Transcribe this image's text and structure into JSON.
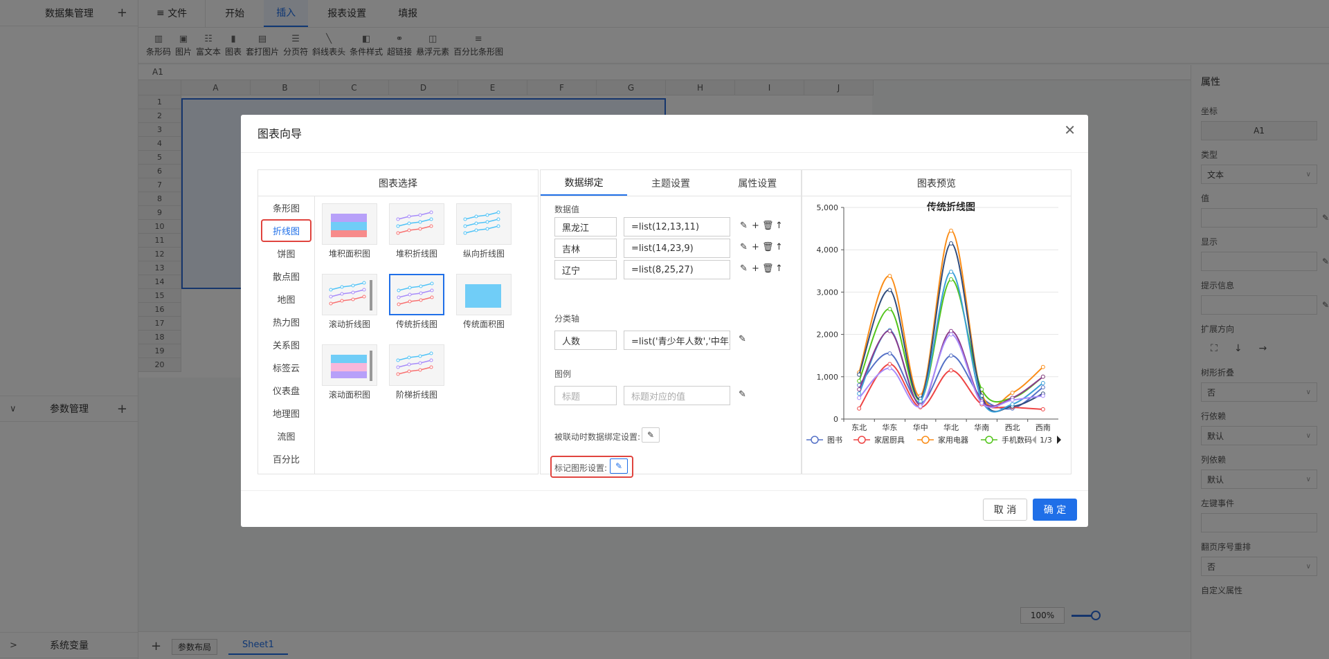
{
  "left_panel": {
    "dataset": "数据集管理",
    "params": "参数管理",
    "sysvars": "系统变量"
  },
  "top": {
    "file": "文件",
    "tabs": [
      "开始",
      "插入",
      "报表设置",
      "填报"
    ],
    "active_tab": "插入"
  },
  "ribbon": [
    {
      "icon": "barcode-icon",
      "label": "条形码"
    },
    {
      "icon": "image-icon",
      "label": "图片"
    },
    {
      "icon": "richtext-icon",
      "label": "富文本"
    },
    {
      "icon": "chart-icon",
      "label": "图表"
    },
    {
      "icon": "print-image-icon",
      "label": "套打图片"
    },
    {
      "icon": "page-break-icon",
      "label": "分页符"
    },
    {
      "icon": "diagonal-header-icon",
      "label": "斜线表头"
    },
    {
      "icon": "condition-style-icon",
      "label": "条件样式"
    },
    {
      "icon": "link-icon",
      "label": "超链接"
    },
    {
      "icon": "float-element-icon",
      "label": "悬浮元素"
    },
    {
      "icon": "percent-bar-icon",
      "label": "百分比条形图"
    }
  ],
  "cell_ref": "A1",
  "columns": [
    "A",
    "B",
    "C",
    "D",
    "E",
    "F",
    "G",
    "H",
    "I",
    "J"
  ],
  "rows": [
    "1",
    "2",
    "3",
    "4",
    "5",
    "6",
    "7",
    "8",
    "9",
    "10",
    "11",
    "12",
    "13",
    "14",
    "15",
    "16",
    "17",
    "18",
    "19",
    "20"
  ],
  "bottom": {
    "param_layout": "参数布局",
    "sheet": "Sheet1",
    "zoom": "100%"
  },
  "right_panel": {
    "title": "属性",
    "coord_label": "坐标",
    "coord_value": "A1",
    "type_label": "类型",
    "type_value": "文本",
    "value_label": "值",
    "display_label": "显示",
    "tip_label": "提示信息",
    "expand_label": "扩展方向",
    "tree_label": "树形折叠",
    "tree_value": "否",
    "row_dep_label": "行依赖",
    "row_dep_value": "默认",
    "col_dep_label": "列依赖",
    "col_dep_value": "默认",
    "left_click_label": "左键事件",
    "page_reorder_label": "翻页序号重排",
    "page_reorder_value": "否",
    "custom_attr_label": "自定义属性"
  },
  "modal": {
    "title": "图表向导",
    "cancel": "取 消",
    "ok": "确 定",
    "chart_select": {
      "title": "图表选择",
      "categories": [
        "条形图",
        "折线图",
        "饼图",
        "散点图",
        "地图",
        "热力图",
        "关系图",
        "标签云",
        "仪表盘",
        "地理图",
        "流图",
        "百分比"
      ],
      "active": "折线图",
      "thumbs": [
        "堆积面积图",
        "堆积折线图",
        "纵向折线图",
        "滚动折线图",
        "传统折线图",
        "传统面积图",
        "滚动面积图",
        "阶梯折线图"
      ],
      "selected": "传统折线图"
    },
    "binding": {
      "tabs": [
        "数据绑定",
        "主题设置",
        "属性设置"
      ],
      "data_value": "数据值",
      "series": [
        {
          "name": "黑龙江",
          "expr": "=list(12,13,11)"
        },
        {
          "name": "吉林",
          "expr": "=list(14,23,9)"
        },
        {
          "name": "辽宁",
          "expr": "=list(8,25,27)"
        }
      ],
      "category_axis": "分类轴",
      "cat_name": "人数",
      "cat_expr": "=list('青少年人数','中年人数')",
      "legend": "图例",
      "legend_ph1": "标题",
      "legend_ph2": "标题对应的值",
      "linked": "被联动时数据绑定设置:",
      "marker": "标记图形设置:"
    },
    "preview": {
      "title": "图表预览",
      "legend_page": "1/3"
    }
  },
  "chart_data": {
    "type": "line",
    "title": "传统折线图",
    "categories": [
      "东北",
      "华东",
      "华中",
      "华北",
      "华南",
      "西北",
      "西南"
    ],
    "ylim": [
      0,
      5000
    ],
    "yticks": [
      "0",
      "1,000",
      "2,000",
      "3,000",
      "4,000",
      "5,000"
    ],
    "series": [
      {
        "name": "图书",
        "color": "#5470c6",
        "values": [
          800,
          1550,
          380,
          1500,
          500,
          250,
          750
        ]
      },
      {
        "name": "家居厨具",
        "color": "#ee4444",
        "values": [
          250,
          1300,
          280,
          1150,
          350,
          280,
          230
        ]
      },
      {
        "name": "家用电器",
        "color": "#fa8c16",
        "values": [
          1100,
          3380,
          550,
          4450,
          600,
          620,
          1230
        ]
      },
      {
        "name": "手机数码",
        "color": "#52c41a",
        "values": [
          900,
          2600,
          450,
          3300,
          700,
          500,
          1000
        ]
      },
      {
        "name": "",
        "color": "#2f4b7c",
        "values": [
          1050,
          3050,
          480,
          4150,
          550,
          300,
          600
        ]
      },
      {
        "name": "",
        "color": "#3ba0d8",
        "values": [
          600,
          2100,
          420,
          3480,
          450,
          350,
          850
        ]
      },
      {
        "name": "",
        "color": "#8b3a8b",
        "values": [
          700,
          2080,
          330,
          2080,
          420,
          500,
          1000
        ]
      },
      {
        "name": "",
        "color": "#a78bfa",
        "values": [
          500,
          1200,
          300,
          2000,
          380,
          450,
          550
        ]
      }
    ]
  }
}
